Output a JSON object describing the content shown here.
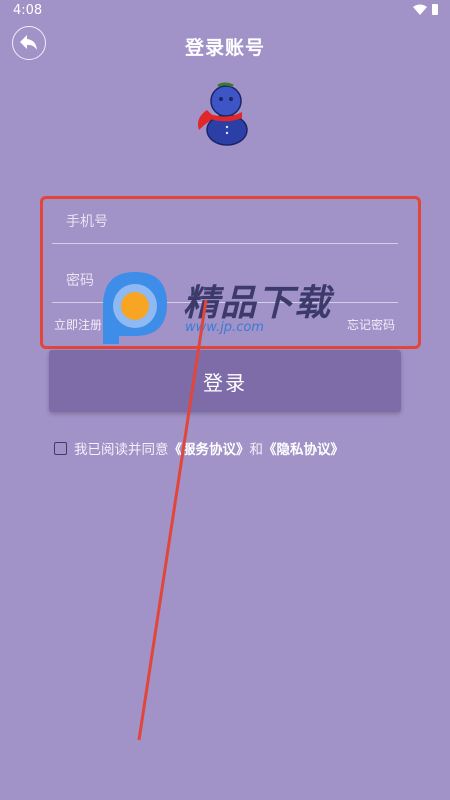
{
  "status_bar": {
    "time": "4:08"
  },
  "header": {
    "title": "登录账号"
  },
  "form": {
    "phone_placeholder": "手机号",
    "password_placeholder": "密码",
    "register_link": "立即注册",
    "forgot_link": "忘记密码",
    "login_button": "登录"
  },
  "agreement": {
    "prefix": "我已阅读并同意",
    "service_terms": "《服务协议》",
    "conjunction": "和",
    "privacy_terms": "《隐私协议》",
    "checked": false
  },
  "watermark": {
    "title": "精品下载",
    "url": "www.jp.com"
  },
  "colors": {
    "background": "#a192c8",
    "button": "#7e6ca9",
    "annotation_red": "#e2453a"
  }
}
